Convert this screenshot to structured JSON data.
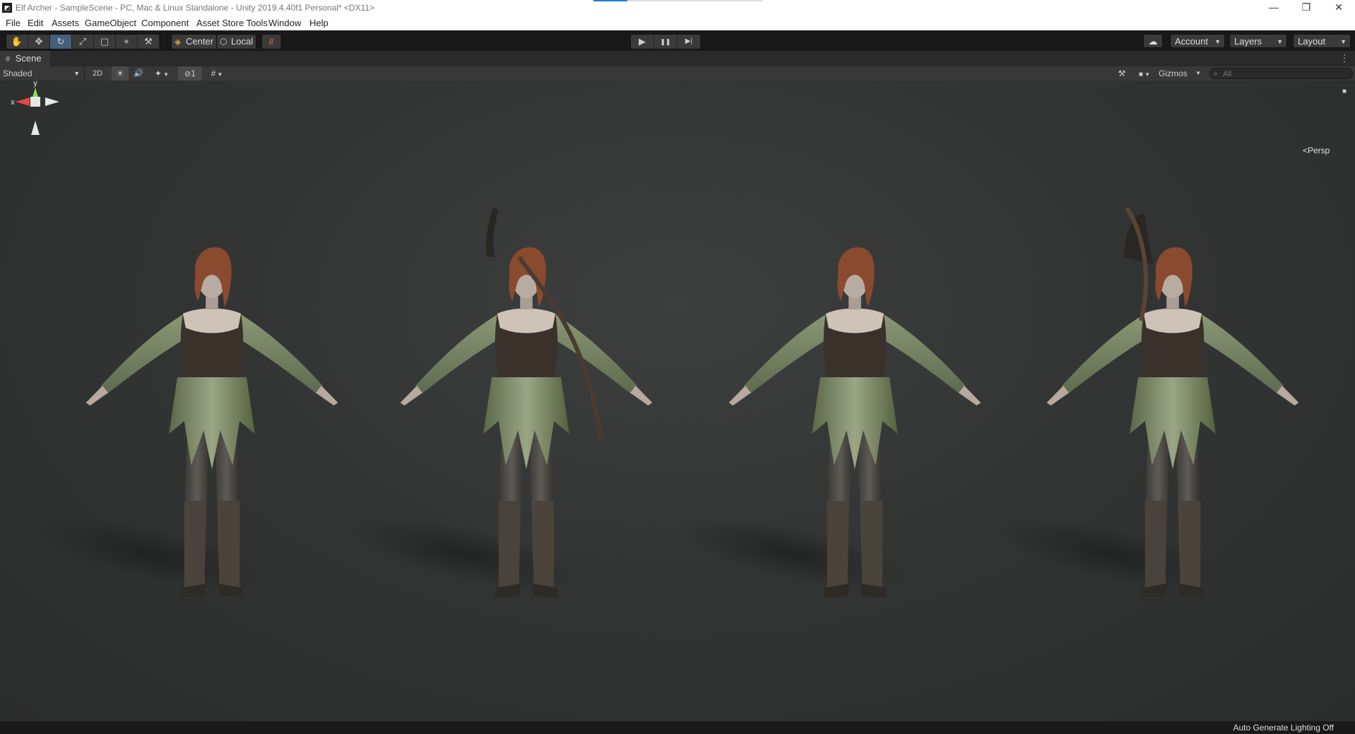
{
  "window": {
    "title": "Elf Archer - SampleScene - PC, Mac & Linux Standalone - Unity 2019.4.40f1 Personal* <DX11>",
    "app_icon": "◩",
    "controls": {
      "minimize": "—",
      "restore": "❐",
      "close": "✕"
    }
  },
  "menu": [
    "File",
    "Edit",
    "Assets",
    "GameObject",
    "Component",
    "Asset Store Tools",
    "Window",
    "Help"
  ],
  "toolbar": {
    "tools": [
      {
        "name": "hand-tool",
        "glyph": "✋"
      },
      {
        "name": "move-tool",
        "glyph": "✥"
      },
      {
        "name": "rotate-tool",
        "glyph": "↻"
      },
      {
        "name": "scale-tool",
        "glyph": "⤢"
      },
      {
        "name": "rect-tool",
        "glyph": "▢"
      },
      {
        "name": "transform-tool",
        "glyph": "⌖"
      },
      {
        "name": "custom-tool",
        "glyph": "⚒"
      }
    ],
    "active_tool": "rotate-tool",
    "pivot_label": "Center",
    "pivot_icon": "◈",
    "space_label": "Local",
    "space_icon": "⬡",
    "grid_snap_icon": "#",
    "play": {
      "play": "▶",
      "pause": "❚❚",
      "step": "▶|"
    },
    "cloud_icon": "☁",
    "account_label": "Account",
    "layers_label": "Layers",
    "layout_label": "Layout"
  },
  "scene_tab": {
    "label": "Scene",
    "icon": "#"
  },
  "scene_toolbar": {
    "draw_mode": "Shaded",
    "mode_2d": "2D",
    "lighting_icon": "☀",
    "audio_icon": "🔊",
    "effects_icon": "✦",
    "hidden_count": "1",
    "grid_icon": "#",
    "tools_icon": "⚒",
    "camera_icon": "■",
    "gizmos_label": "Gizmos",
    "search_placeholder": "All"
  },
  "viewport": {
    "persp_label": "<Persp",
    "axis_x": "x",
    "axis_y": "y"
  },
  "status": {
    "message": "Auto Generate Lighting Off"
  }
}
